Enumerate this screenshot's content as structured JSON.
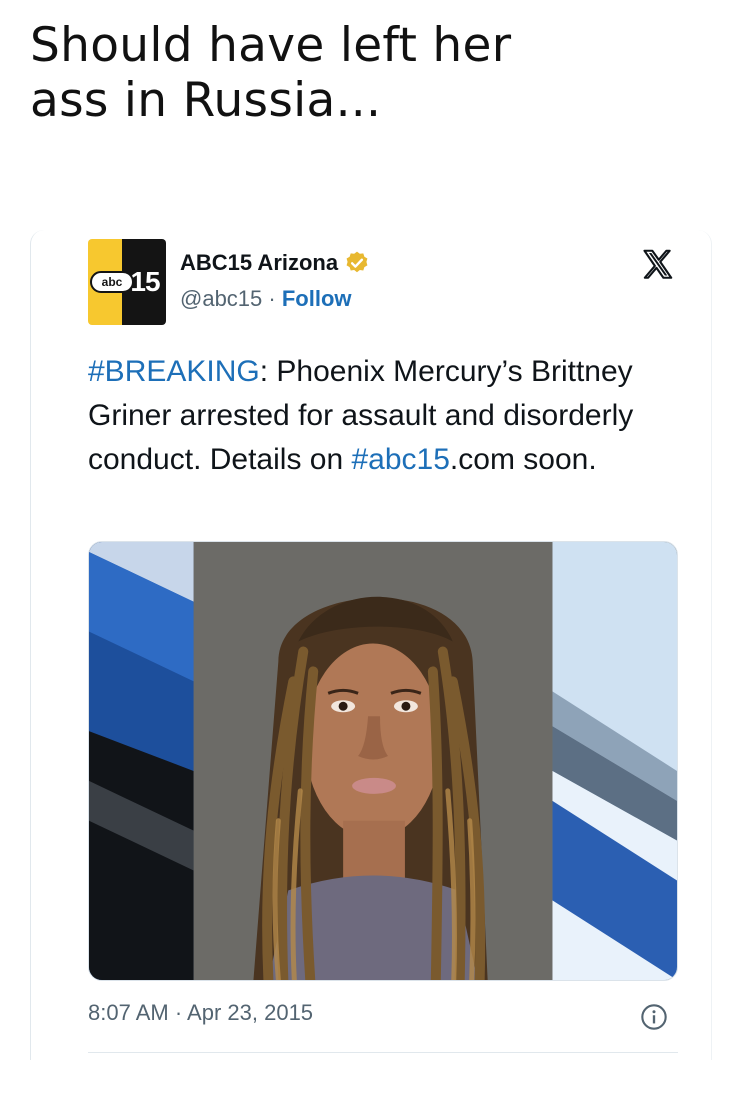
{
  "caption": {
    "line1": "Should have left her",
    "line2": "ass in Russia..."
  },
  "tweet": {
    "author_name": "ABC15 Arizona",
    "logo_text": "15",
    "logo_badge": "abc",
    "handle": "@abc15",
    "separator": " · ",
    "follow_label": "Follow",
    "text_hashtag": "#BREAKING",
    "text_body": ": Phoenix Mercury’s Brittney Griner arrested for assault and disorderly conduct. Details on ",
    "text_link": "#abc15",
    "text_tail": ".com soon.",
    "timestamp": "8:07 AM · Apr 23, 2015",
    "platform_icon": "x-logo-icon",
    "verified_icon": "verified-badge-icon",
    "info_icon": "info-icon"
  },
  "colors": {
    "link": "#1d6fb8",
    "secondary": "#536471",
    "verified": "#e8b830",
    "logo_yellow": "#f7c82f"
  }
}
